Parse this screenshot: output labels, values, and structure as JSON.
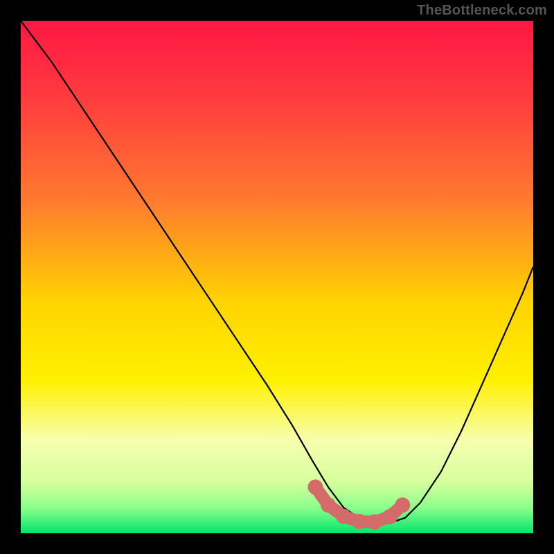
{
  "watermark": "TheBottleneck.com",
  "chart_data": {
    "type": "line",
    "title": "",
    "xlabel": "",
    "ylabel": "",
    "xlim": [
      0,
      100
    ],
    "ylim": [
      0,
      100
    ],
    "grid": false,
    "legend": false,
    "gradient_stops": [
      {
        "offset": 0.0,
        "color": "#ff1744"
      },
      {
        "offset": 0.15,
        "color": "#ff3b3f"
      },
      {
        "offset": 0.35,
        "color": "#ff7a2f"
      },
      {
        "offset": 0.55,
        "color": "#ffd400"
      },
      {
        "offset": 0.7,
        "color": "#fff000"
      },
      {
        "offset": 0.82,
        "color": "#f6ffb0"
      },
      {
        "offset": 0.9,
        "color": "#d6ff9c"
      },
      {
        "offset": 0.95,
        "color": "#8cff8c"
      },
      {
        "offset": 1.0,
        "color": "#00e56b"
      }
    ],
    "series": [
      {
        "name": "bottleneck-curve",
        "x": [
          0,
          6,
          12,
          18,
          24,
          30,
          36,
          42,
          48,
          53,
          57,
          60,
          63,
          66,
          69,
          72,
          75,
          78,
          82,
          86,
          90,
          94,
          98,
          100
        ],
        "values": [
          100,
          92,
          83,
          74,
          65,
          56,
          47,
          38,
          29,
          21,
          14,
          9,
          5,
          3,
          2,
          2,
          3,
          6,
          12,
          20,
          29,
          38,
          47,
          52
        ]
      }
    ],
    "highlight_band": {
      "name": "sweet-spot",
      "x_nodes": [
        57.5,
        60,
        63,
        66,
        69,
        72,
        74.5
      ],
      "y_nodes": [
        9,
        5.5,
        3.3,
        2.3,
        2.2,
        3.2,
        5.5
      ],
      "color": "#d46a6a",
      "node_radius": 11,
      "stroke_width": 18
    }
  }
}
